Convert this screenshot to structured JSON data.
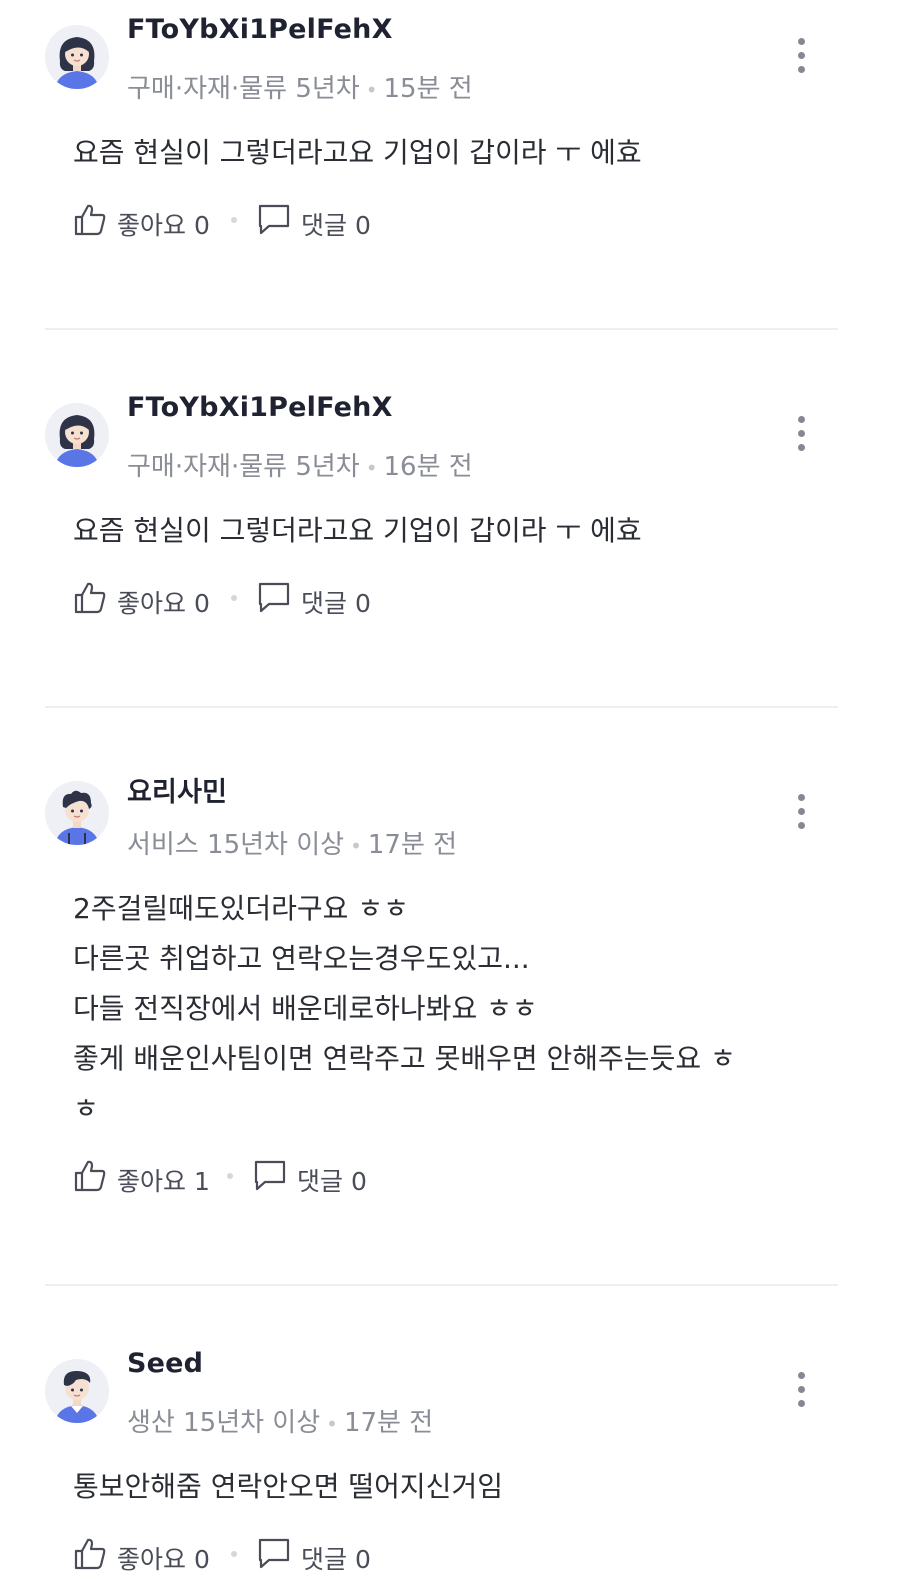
{
  "comments": [
    {
      "username": "FToYbXi1PelFehX",
      "meta": "구매·자재·물류 5년차",
      "time": "15분 전",
      "body": "요즘 현실이 그렇더라고요 기업이 갑이라 ㅜ 에효",
      "like_label": "좋아요",
      "like_count": "0",
      "reply_label": "댓글",
      "reply_count": "0",
      "avatar": "woman-avatar"
    },
    {
      "username": "FToYbXi1PelFehX",
      "meta": "구매·자재·물류 5년차",
      "time": "16분 전",
      "body": "요즘 현실이 그렇더라고요 기업이 갑이라 ㅜ 에효",
      "like_label": "좋아요",
      "like_count": "0",
      "reply_label": "댓글",
      "reply_count": "0",
      "avatar": "woman-avatar"
    },
    {
      "username": "요리사민",
      "meta": "서비스 15년차 이상",
      "time": "17분 전",
      "body": "2주걸릴때도있더라구요 ㅎㅎ\n다른곳 취업하고 연락오는경우도있고...\n다들 전직장에서 배운데로하나봐요 ㅎㅎ\n좋게 배운인사팀이면 연락주고 못배우면 안해주는듯요 ㅎ\nㅎ",
      "like_label": "좋아요",
      "like_count": "1",
      "reply_label": "댓글",
      "reply_count": "0",
      "avatar": "man-curly-avatar"
    },
    {
      "username": "Seed",
      "meta": "생산 15년차 이상",
      "time": "17분 전",
      "body": "통보안해줌 연락안오면 떨어지신거임",
      "like_label": "좋아요",
      "like_count": "0",
      "reply_label": "댓글",
      "reply_count": "0",
      "avatar": "man-avatar"
    }
  ],
  "colors": {
    "username": "#1f2230",
    "meta": "#8a8d96",
    "body": "#2b2d35",
    "avatar_bg": "#eef0f6",
    "avatar_shirt": "#5a76e6",
    "divider": "#eceef1"
  },
  "icons": [
    "woman-avatar",
    "man-curly-avatar",
    "man-avatar",
    "more-vertical-icon",
    "thumbs-up-icon",
    "comment-bubble-icon"
  ]
}
